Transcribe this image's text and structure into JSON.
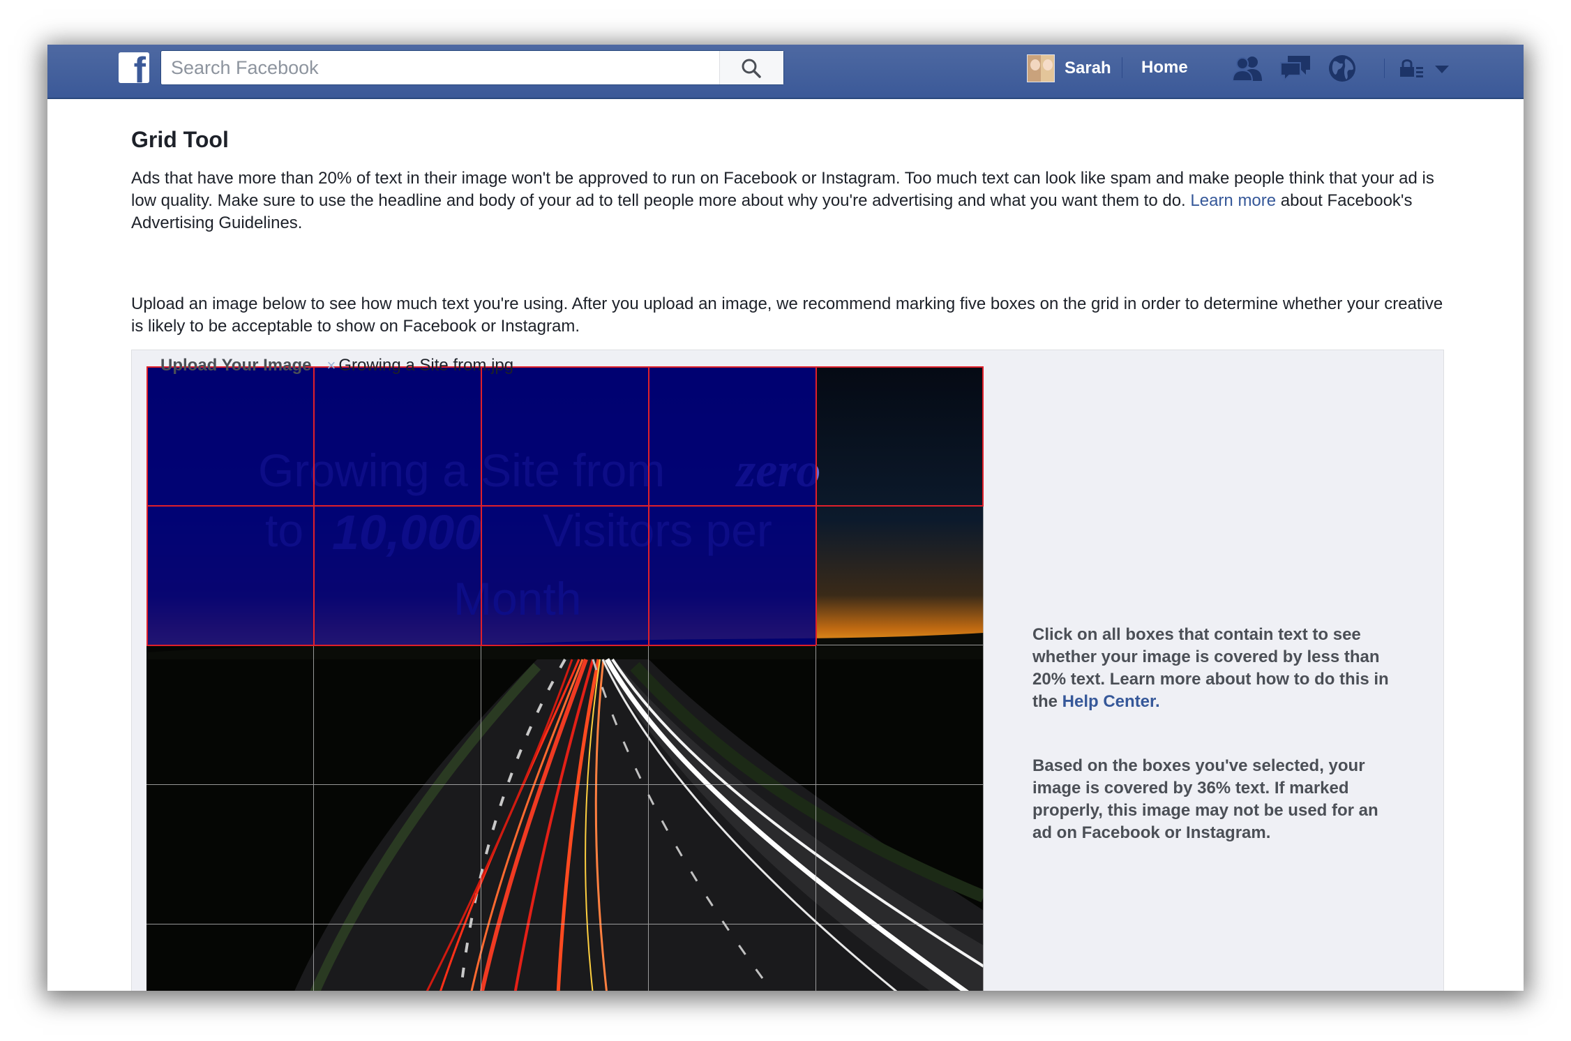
{
  "header": {
    "logo_letter": "f",
    "search_placeholder": "Search Facebook",
    "user_name": "Sarah",
    "home_label": "Home"
  },
  "page": {
    "title": "Grid Tool",
    "intro_part1": "Ads that have more than 20% of text in their image won't be approved to run on Facebook or Instagram. Too much text can look like spam and make people think that your ad is low quality. Make sure to use the headline and body of your ad to tell people more about why you're advertising and what you want them to do. ",
    "intro_link": "Learn more",
    "intro_part2": " about Facebook's Advertising Guidelines.",
    "upload_instructions": "Upload an image below to see how much text you're using. After you upload an image, we recommend marking five boxes on the grid in order to determine whether your creative is likely to be acceptable to show on Facebook or Instagram.",
    "upload_label": "Upload Your Image",
    "remove_icon": "×",
    "file_name": "Growing a Site from.jpg"
  },
  "image": {
    "line1": "Growing a Site from",
    "line1_script": "zero",
    "line2_to": "to",
    "line2_number": "10,000",
    "line2_rest": "Visitors per",
    "line3": "Month"
  },
  "grid": {
    "rows": 5,
    "cols": 5,
    "selected_cells": [
      [
        0,
        0
      ],
      [
        0,
        1
      ],
      [
        0,
        2
      ],
      [
        0,
        3
      ],
      [
        1,
        0
      ],
      [
        1,
        1
      ],
      [
        1,
        2
      ],
      [
        1,
        3
      ]
    ]
  },
  "sidebar": {
    "instructions": "Click on all boxes that contain text to see whether your image is covered by less than 20% text. Learn more about how to do this in the ",
    "help_link": "Help Center.",
    "result": "Based on the boxes you've selected, your image is covered by 36% text. If marked properly, this image may not be used for an ad on Facebook or Instagram."
  },
  "colors": {
    "fb_blue": "#3b5998",
    "link": "#365899",
    "selection": "#000080",
    "selection_border": "#e0202a"
  },
  "icons": [
    "search-icon",
    "friends-icon",
    "messages-icon",
    "globe-icon",
    "privacy-lock-icon",
    "chevron-down-icon"
  ]
}
